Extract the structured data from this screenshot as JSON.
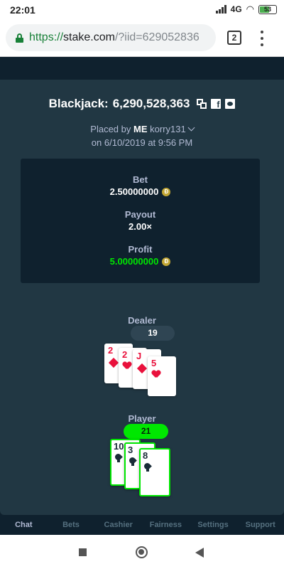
{
  "status_bar": {
    "time": "22:01",
    "network": "4G",
    "battery": "53"
  },
  "browser": {
    "url_protocol": "https://",
    "url_host": "stake.com",
    "url_rest": "/?iid=629052836",
    "tab_count": "2"
  },
  "bet": {
    "game": "Blackjack:",
    "bet_id": "6,290,528,363",
    "placed_by_prefix": "Placed by",
    "user_badge": "ME",
    "username": "korry131",
    "date": "on 6/10/2019 at 9:56 PM",
    "bet_label": "Bet",
    "bet_amount": "2.50000000",
    "payout_label": "Payout",
    "payout": "2.00×",
    "profit_label": "Profit",
    "profit": "5.00000000",
    "currency_symbol": "Ð"
  },
  "dealer": {
    "label": "Dealer",
    "total": "19",
    "cards": [
      {
        "rank": "2",
        "suit": "diamond-icon"
      },
      {
        "rank": "2",
        "suit": "heart-icon"
      },
      {
        "rank": "J",
        "suit": "diamond-icon"
      },
      {
        "rank": "5",
        "suit": "heart-icon"
      }
    ]
  },
  "player": {
    "label": "Player",
    "total": "21",
    "cards": [
      {
        "rank": "10",
        "suit": "spade-icon"
      },
      {
        "rank": "3",
        "suit": "spade-icon"
      },
      {
        "rank": "8",
        "suit": "spade-icon"
      }
    ]
  },
  "tabs": [
    "Chat",
    "Bets",
    "Cashier",
    "Fairness",
    "Settings",
    "Support"
  ],
  "colors": {
    "win": "#00e701",
    "red_suit": "#e9113c",
    "panel": "#213743",
    "dark": "#0f212e"
  }
}
